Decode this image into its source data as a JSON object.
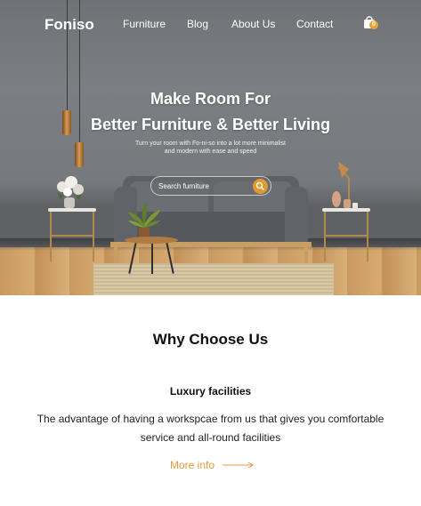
{
  "nav": {
    "brand": "Foniso",
    "links": [
      "Furniture",
      "Blog",
      "About Us",
      "Contact"
    ],
    "cart_count": "0",
    "icons": {
      "cart": "shopping-bag-icon"
    }
  },
  "hero": {
    "title_line1": "Make Room For",
    "title_line2": "Better Furniture & Better Living",
    "subtitle_line1": "Turn your room with Fo-ni-so into a lot more minimalist",
    "subtitle_line2": "and modern with ease and speed",
    "search": {
      "placeholder": "Search furniture",
      "value": ""
    }
  },
  "section": {
    "title": "Why Choose Us",
    "feature": {
      "title": "Luxury facilities",
      "description": "The advantage of having a workspcae from us that gives you comfortable service and all-round facilities",
      "link_label": "More info"
    }
  },
  "colors": {
    "accent": "#e09a2f",
    "text": "#111111",
    "wall": "#7a7d81"
  }
}
